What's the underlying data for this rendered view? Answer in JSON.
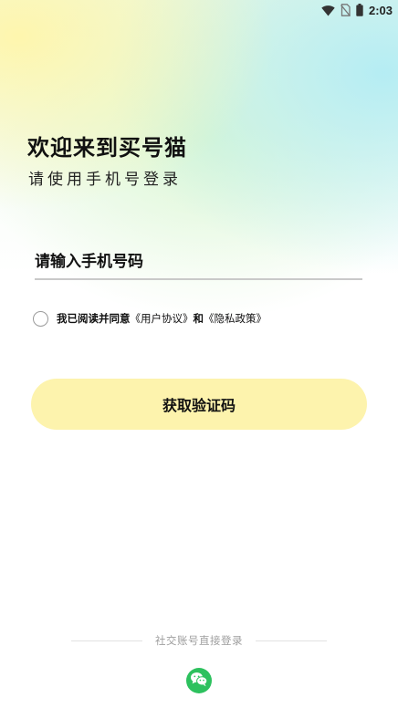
{
  "status_bar": {
    "time": "2:03",
    "icons": [
      "wifi-icon",
      "no-sim-icon",
      "battery-icon"
    ]
  },
  "login": {
    "title": "欢迎来到买号猫",
    "subtitle": "请使用手机号登录",
    "phone_placeholder": "请输入手机号码",
    "agreement": {
      "checked": false,
      "prefix": "我已阅读并同意",
      "user_agreement": "《用户协议》",
      "conjunction": "和",
      "privacy_policy": "《隐私政策》"
    },
    "get_code_button": "获取验证码",
    "social_login_label": "社交账号直接登录",
    "social_icons": [
      "wechat-icon"
    ]
  },
  "colors": {
    "button_bg": "#fdf3ad",
    "wechat_green": "#2dc15e",
    "divider": "#e2e2e2",
    "muted_text": "#9e9e9e"
  }
}
